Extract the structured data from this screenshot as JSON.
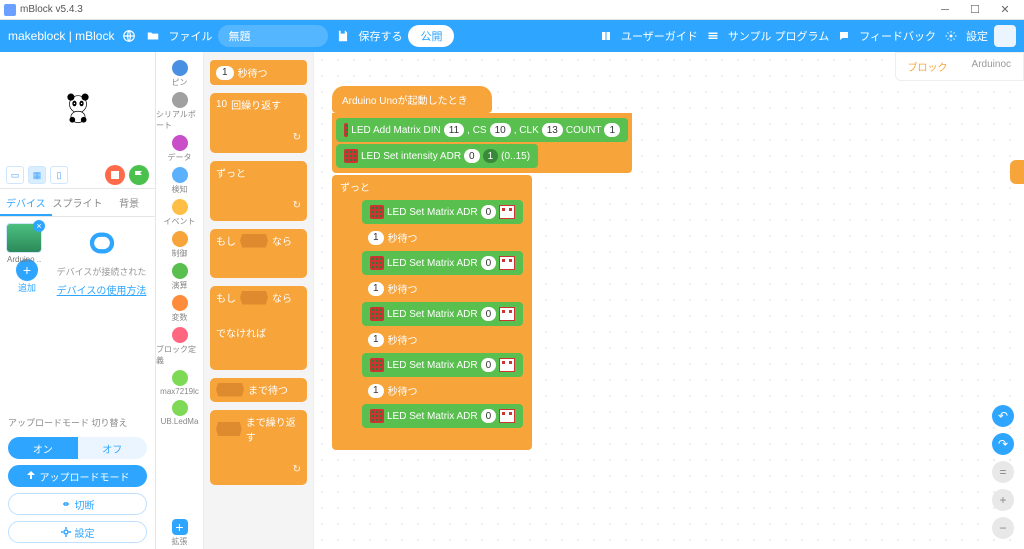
{
  "window": {
    "title": "mBlock v5.4.3"
  },
  "topbar": {
    "brand": "makeblock | mBlock",
    "file": "ファイル",
    "title_field": "無題",
    "save": "保存する",
    "publish": "公開",
    "links": {
      "userguide": "ユーザーガイド",
      "samples": "サンプル プログラム",
      "feedback": "フィードバック",
      "settings": "設定"
    }
  },
  "left": {
    "tabs": {
      "device": "デバイス",
      "sprite": "スプライト",
      "background": "背景"
    },
    "device_name": "Arduino ...",
    "add": "追加",
    "connected_hint": "デバイスが接続された",
    "usage_link": "デバイスの使用方法",
    "upload_mode_label": "アップロードモード 切り替え",
    "on": "オン",
    "off": "オフ",
    "upload_btn": "アップロードモード",
    "disconnect": "切断",
    "settings": "設定"
  },
  "categories": [
    {
      "label": "ピン",
      "color": "#4a90e2"
    },
    {
      "label": "シリアルポート",
      "color": "#a0a0a0"
    },
    {
      "label": "データ",
      "color": "#c94fc9"
    },
    {
      "label": "検知",
      "color": "#5cb1ff"
    },
    {
      "label": "イベント",
      "color": "#ffbf47"
    },
    {
      "label": "制御",
      "color": "#f7a43b"
    },
    {
      "label": "演算",
      "color": "#59bf4f"
    },
    {
      "label": "変数",
      "color": "#ff8c3b"
    },
    {
      "label": "ブロック定義",
      "color": "#ff6680"
    },
    {
      "label": "max7219lc",
      "color": "#7ed957"
    },
    {
      "label": "UB.LedMa",
      "color": "#7ed957"
    }
  ],
  "palette": {
    "wait": {
      "val": "1",
      "label": "秒待つ"
    },
    "repeat": {
      "val": "10",
      "label": "回繰り返す"
    },
    "forever": "ずっと",
    "if": "もし",
    "then": "なら",
    "else": "でなければ",
    "until": "まで待つ",
    "repeat_until": "まで繰り返す"
  },
  "ext_label": "拡張",
  "workspace": {
    "tabs": {
      "blocks": "ブロック",
      "arduino": "Arduinoc"
    },
    "hat": "Arduino Unoが起動したとき",
    "add_matrix": {
      "label": "LED Add Matrix DIN",
      "din": "11",
      "cs_lbl": ", CS",
      "cs": "10",
      "clk_lbl": ", CLK",
      "clk": "13",
      "count_lbl": "COUNT",
      "count": "1"
    },
    "set_intensity": {
      "label": "LED Set intensity ADR",
      "adr": "0",
      "val": "1",
      "range": "(0..15)"
    },
    "forever": "ずっと",
    "set_matrix_label": "LED Set Matrix ADR",
    "set_matrix_adr": "0",
    "wait_val": "1",
    "wait_label": "秒待つ"
  }
}
